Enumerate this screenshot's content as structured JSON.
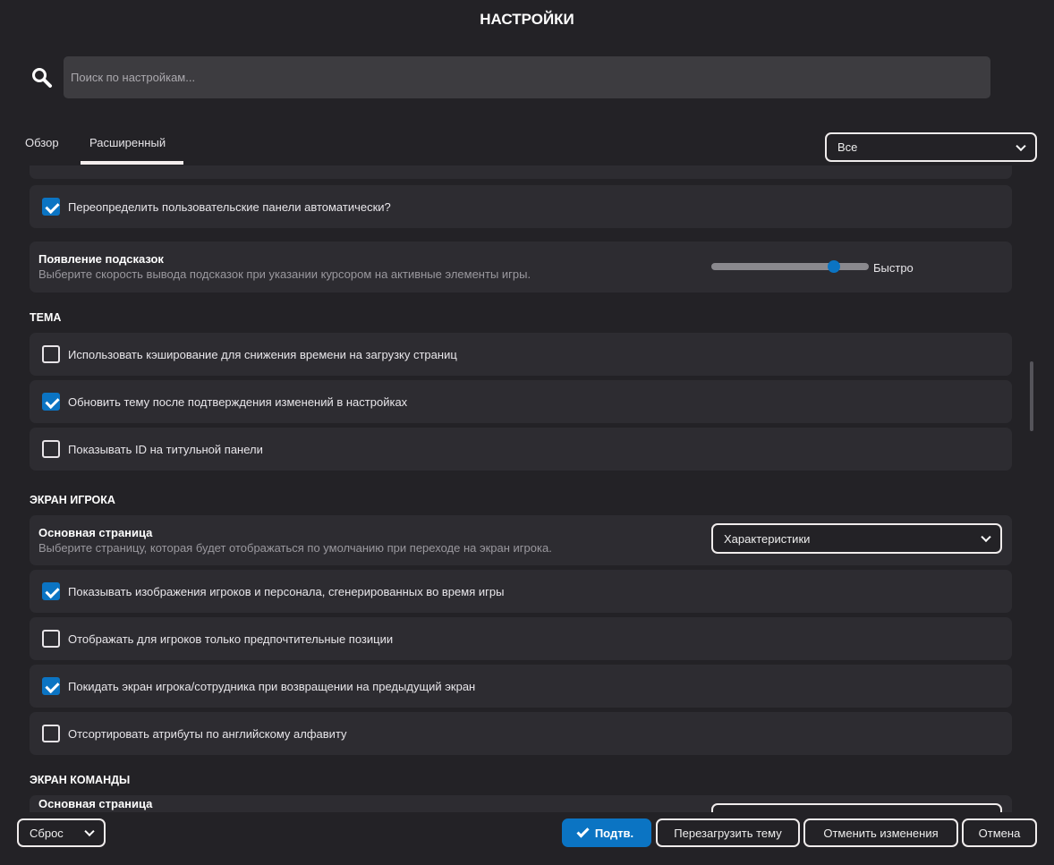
{
  "title": "НАСТРОЙКИ",
  "search": {
    "placeholder": "Поиск по настройкам..."
  },
  "tabs": [
    {
      "label": "Обзор"
    },
    {
      "label": "Расширенный"
    }
  ],
  "filter": {
    "value": "Все"
  },
  "settings": {
    "override_panels": {
      "label": "Переопределить пользовательские панели автоматически?",
      "checked": true
    },
    "tooltips": {
      "title": "Появление подсказок",
      "description": "Выберите скорость вывода подсказок при указании курсором на активные элементы игры.",
      "value_label": "Быстро",
      "level": 0.78
    }
  },
  "theme": {
    "heading": "ТЕМА",
    "items": [
      {
        "label": "Использовать кэширование для снижения времени на загрузку страниц",
        "checked": false
      },
      {
        "label": "Обновить тему после подтверждения изменений в настройках",
        "checked": true
      },
      {
        "label": "Показывать ID на титульной панели",
        "checked": false
      }
    ]
  },
  "player_screen": {
    "heading": "ЭКРАН ИГРОКА",
    "main_page": {
      "title": "Основная страница",
      "description": "Выберите страницу, которая будет отображаться по умолчанию при переходе на экран игрока.",
      "value": "Характеристики"
    },
    "items": [
      {
        "label": "Показывать изображения игроков и персонала, сгенерированных во время игры",
        "checked": true
      },
      {
        "label": "Отображать для игроков только предпочтительные позиции",
        "checked": false
      },
      {
        "label": "Покидать экран игрока/сотрудника при возвращении на предыдущий экран",
        "checked": true
      },
      {
        "label": "Отсортировать атрибуты по английскому алфавиту",
        "checked": false
      }
    ]
  },
  "team_screen": {
    "heading": "ЭКРАН КОМАНДЫ",
    "main_page": {
      "title": "Основная страница"
    }
  },
  "footer": {
    "reset": "Сброс",
    "confirm": "Подтв.",
    "reload_theme": "Перезагрузить тему",
    "revert": "Отменить изменения",
    "cancel": "Отмена"
  }
}
